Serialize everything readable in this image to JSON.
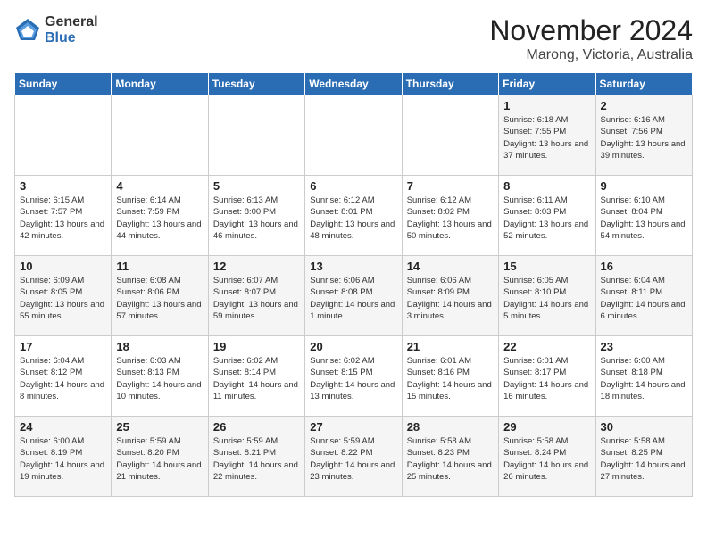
{
  "logo": {
    "general": "General",
    "blue": "Blue"
  },
  "title": "November 2024",
  "location": "Marong, Victoria, Australia",
  "days_of_week": [
    "Sunday",
    "Monday",
    "Tuesday",
    "Wednesday",
    "Thursday",
    "Friday",
    "Saturday"
  ],
  "weeks": [
    [
      {
        "day": "",
        "info": ""
      },
      {
        "day": "",
        "info": ""
      },
      {
        "day": "",
        "info": ""
      },
      {
        "day": "",
        "info": ""
      },
      {
        "day": "",
        "info": ""
      },
      {
        "day": "1",
        "info": "Sunrise: 6:18 AM\nSunset: 7:55 PM\nDaylight: 13 hours and 37 minutes."
      },
      {
        "day": "2",
        "info": "Sunrise: 6:16 AM\nSunset: 7:56 PM\nDaylight: 13 hours and 39 minutes."
      }
    ],
    [
      {
        "day": "3",
        "info": "Sunrise: 6:15 AM\nSunset: 7:57 PM\nDaylight: 13 hours and 42 minutes."
      },
      {
        "day": "4",
        "info": "Sunrise: 6:14 AM\nSunset: 7:59 PM\nDaylight: 13 hours and 44 minutes."
      },
      {
        "day": "5",
        "info": "Sunrise: 6:13 AM\nSunset: 8:00 PM\nDaylight: 13 hours and 46 minutes."
      },
      {
        "day": "6",
        "info": "Sunrise: 6:12 AM\nSunset: 8:01 PM\nDaylight: 13 hours and 48 minutes."
      },
      {
        "day": "7",
        "info": "Sunrise: 6:12 AM\nSunset: 8:02 PM\nDaylight: 13 hours and 50 minutes."
      },
      {
        "day": "8",
        "info": "Sunrise: 6:11 AM\nSunset: 8:03 PM\nDaylight: 13 hours and 52 minutes."
      },
      {
        "day": "9",
        "info": "Sunrise: 6:10 AM\nSunset: 8:04 PM\nDaylight: 13 hours and 54 minutes."
      }
    ],
    [
      {
        "day": "10",
        "info": "Sunrise: 6:09 AM\nSunset: 8:05 PM\nDaylight: 13 hours and 55 minutes."
      },
      {
        "day": "11",
        "info": "Sunrise: 6:08 AM\nSunset: 8:06 PM\nDaylight: 13 hours and 57 minutes."
      },
      {
        "day": "12",
        "info": "Sunrise: 6:07 AM\nSunset: 8:07 PM\nDaylight: 13 hours and 59 minutes."
      },
      {
        "day": "13",
        "info": "Sunrise: 6:06 AM\nSunset: 8:08 PM\nDaylight: 14 hours and 1 minute."
      },
      {
        "day": "14",
        "info": "Sunrise: 6:06 AM\nSunset: 8:09 PM\nDaylight: 14 hours and 3 minutes."
      },
      {
        "day": "15",
        "info": "Sunrise: 6:05 AM\nSunset: 8:10 PM\nDaylight: 14 hours and 5 minutes."
      },
      {
        "day": "16",
        "info": "Sunrise: 6:04 AM\nSunset: 8:11 PM\nDaylight: 14 hours and 6 minutes."
      }
    ],
    [
      {
        "day": "17",
        "info": "Sunrise: 6:04 AM\nSunset: 8:12 PM\nDaylight: 14 hours and 8 minutes."
      },
      {
        "day": "18",
        "info": "Sunrise: 6:03 AM\nSunset: 8:13 PM\nDaylight: 14 hours and 10 minutes."
      },
      {
        "day": "19",
        "info": "Sunrise: 6:02 AM\nSunset: 8:14 PM\nDaylight: 14 hours and 11 minutes."
      },
      {
        "day": "20",
        "info": "Sunrise: 6:02 AM\nSunset: 8:15 PM\nDaylight: 14 hours and 13 minutes."
      },
      {
        "day": "21",
        "info": "Sunrise: 6:01 AM\nSunset: 8:16 PM\nDaylight: 14 hours and 15 minutes."
      },
      {
        "day": "22",
        "info": "Sunrise: 6:01 AM\nSunset: 8:17 PM\nDaylight: 14 hours and 16 minutes."
      },
      {
        "day": "23",
        "info": "Sunrise: 6:00 AM\nSunset: 8:18 PM\nDaylight: 14 hours and 18 minutes."
      }
    ],
    [
      {
        "day": "24",
        "info": "Sunrise: 6:00 AM\nSunset: 8:19 PM\nDaylight: 14 hours and 19 minutes."
      },
      {
        "day": "25",
        "info": "Sunrise: 5:59 AM\nSunset: 8:20 PM\nDaylight: 14 hours and 21 minutes."
      },
      {
        "day": "26",
        "info": "Sunrise: 5:59 AM\nSunset: 8:21 PM\nDaylight: 14 hours and 22 minutes."
      },
      {
        "day": "27",
        "info": "Sunrise: 5:59 AM\nSunset: 8:22 PM\nDaylight: 14 hours and 23 minutes."
      },
      {
        "day": "28",
        "info": "Sunrise: 5:58 AM\nSunset: 8:23 PM\nDaylight: 14 hours and 25 minutes."
      },
      {
        "day": "29",
        "info": "Sunrise: 5:58 AM\nSunset: 8:24 PM\nDaylight: 14 hours and 26 minutes."
      },
      {
        "day": "30",
        "info": "Sunrise: 5:58 AM\nSunset: 8:25 PM\nDaylight: 14 hours and 27 minutes."
      }
    ]
  ]
}
